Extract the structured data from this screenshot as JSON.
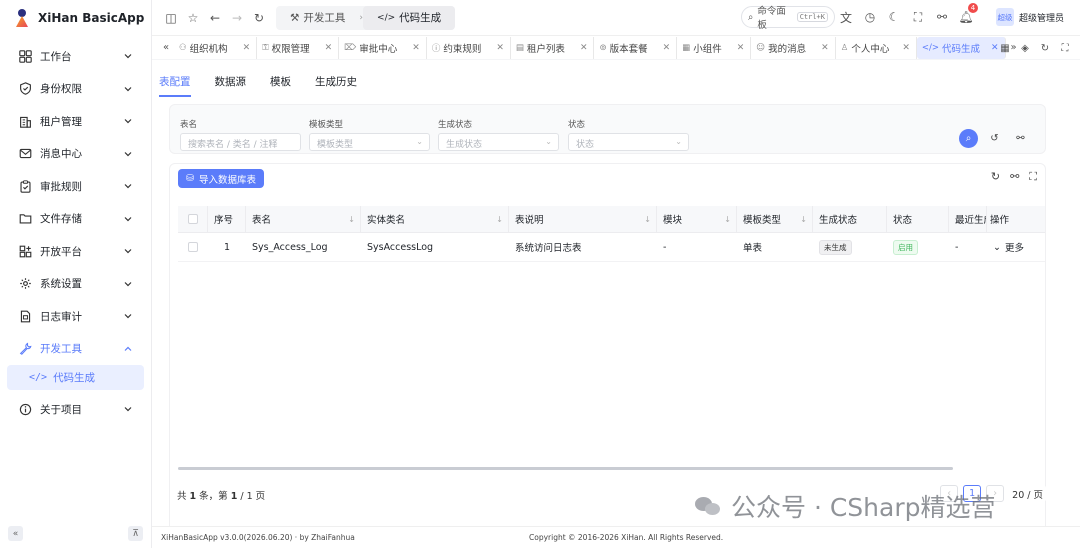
{
  "app": {
    "title": "XiHan BasicApp"
  },
  "sidebar": {
    "items": [
      {
        "label": "工作台",
        "icon": "dashboard-icon"
      },
      {
        "label": "身份权限",
        "icon": "shield-icon"
      },
      {
        "label": "租户管理",
        "icon": "building-icon"
      },
      {
        "label": "消息中心",
        "icon": "mail-icon"
      },
      {
        "label": "审批规则",
        "icon": "clipboard-check-icon"
      },
      {
        "label": "文件存储",
        "icon": "folder-icon"
      },
      {
        "label": "开放平台",
        "icon": "apps-plus-icon"
      },
      {
        "label": "系统设置",
        "icon": "gear-icon"
      },
      {
        "label": "日志审计",
        "icon": "file-log-icon"
      },
      {
        "label": "开发工具",
        "icon": "wrench-icon"
      },
      {
        "label": "关于项目",
        "icon": "info-icon"
      }
    ],
    "sub_item": {
      "label": "代码生成",
      "icon": "code-icon"
    }
  },
  "header": {
    "breadcrumb": [
      "开发工具",
      "代码生成"
    ],
    "command_label": "命令面板",
    "command_shortcut": "Ctrl+K",
    "notification_count": "4",
    "avatar_text": "超级",
    "user_name": "超级管理员"
  },
  "tabs": [
    {
      "label": "组织机构",
      "icon": "org-icon"
    },
    {
      "label": "权限管理",
      "icon": "key-icon"
    },
    {
      "label": "审批中心",
      "icon": "approval-icon"
    },
    {
      "label": "约束规则",
      "icon": "rule-icon"
    },
    {
      "label": "租户列表",
      "icon": "list-icon"
    },
    {
      "label": "版本套餐",
      "icon": "package-icon"
    },
    {
      "label": "小组件",
      "icon": "widget-icon"
    },
    {
      "label": "我的消息",
      "icon": "message-icon"
    },
    {
      "label": "个人中心",
      "icon": "user-icon"
    },
    {
      "label": "代码生成",
      "icon": "code-icon",
      "active": true
    }
  ],
  "content_tabs": [
    "表配置",
    "数据源",
    "模板",
    "生成历史"
  ],
  "filters": [
    {
      "label": "表名",
      "placeholder": "搜索表名 / 类名 / 注释"
    },
    {
      "label": "模板类型",
      "placeholder": "模板类型"
    },
    {
      "label": "生成状态",
      "placeholder": "生成状态"
    },
    {
      "label": "状态",
      "placeholder": "状态"
    }
  ],
  "import_button": "导入数据库表",
  "table": {
    "columns": [
      "序号",
      "表名",
      "实体类名",
      "表说明",
      "模块",
      "模板类型",
      "生成状态",
      "状态",
      "最近生成",
      "操作"
    ],
    "rows": [
      {
        "index": "1",
        "table_name": "Sys_Access_Log",
        "entity": "SysAccessLog",
        "desc": "系统访问日志表",
        "module": "-",
        "template": "单表",
        "gen_status": "未生成",
        "status": "启用",
        "last_gen": "-",
        "action": "更多"
      }
    ]
  },
  "pagination": {
    "summary_prefix": "共 ",
    "total": "1",
    "summary_mid": " 条，第 ",
    "page": "1",
    "summary_sep": " / ",
    "pages": "1",
    "summary_suffix": " 页",
    "current": "1",
    "page_size": "20 / 页"
  },
  "footer": {
    "version": "XiHanBasicApp v3.0.0(2026.06.20) · by ZhaiFanhua",
    "copyright": "Copyright © 2016-2026 XiHan. All Rights Reserved."
  },
  "watermark": "公众号 · CSharp精选营",
  "colors": {
    "accent": "#5b7cfa",
    "success": "#3fb55b",
    "badge": "#f04b4b"
  }
}
